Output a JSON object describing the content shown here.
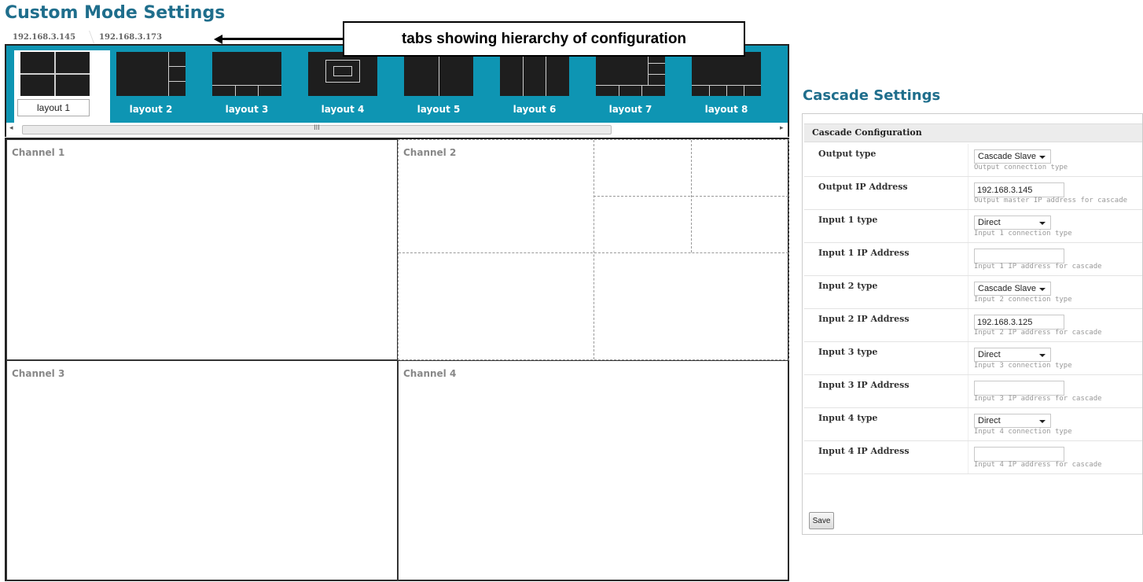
{
  "page": {
    "title": "Custom Mode Settings"
  },
  "breadcrumb": [
    "192.168.3.145",
    "192.168.3.173"
  ],
  "annotation": {
    "text": "tabs showing hierarchy of configuration"
  },
  "layouts": [
    {
      "label": "layout 1",
      "active": true
    },
    {
      "label": "layout 2",
      "active": false
    },
    {
      "label": "layout 3",
      "active": false
    },
    {
      "label": "layout 4",
      "active": false
    },
    {
      "label": "layout 5",
      "active": false
    },
    {
      "label": "layout 6",
      "active": false
    },
    {
      "label": "layout 7",
      "active": false
    },
    {
      "label": "layout 8",
      "active": false
    }
  ],
  "scrollbar": {
    "grip": "III",
    "left_arrow": "◂",
    "right_arrow": "▸"
  },
  "channels": [
    "Channel 1",
    "Channel 2",
    "Channel 3",
    "Channel 4"
  ],
  "cascade": {
    "title": "Cascade Settings",
    "header": "Cascade Configuration",
    "fields": [
      {
        "label": "Output type",
        "kind": "select",
        "value": "Cascade Slave",
        "help": "Output connection type"
      },
      {
        "label": "Output IP Address",
        "kind": "text",
        "value": "192.168.3.145",
        "help": "Output master IP address for cascade"
      },
      {
        "label": "Input 1 type",
        "kind": "select",
        "value": "Direct",
        "help": "Input 1 connection type"
      },
      {
        "label": "Input 1 IP Address",
        "kind": "text",
        "value": "",
        "help": "Input 1 IP address for cascade"
      },
      {
        "label": "Input 2 type",
        "kind": "select",
        "value": "Cascade Slave",
        "help": "Input 2 connection type"
      },
      {
        "label": "Input 2 IP Address",
        "kind": "text",
        "value": "192.168.3.125",
        "help": "Input 2 IP address for cascade"
      },
      {
        "label": "Input 3 type",
        "kind": "select",
        "value": "Direct",
        "help": "Input 3 connection type"
      },
      {
        "label": "Input 3 IP Address",
        "kind": "text",
        "value": "",
        "help": "Input 3 IP address for cascade"
      },
      {
        "label": "Input 4 type",
        "kind": "select",
        "value": "Direct",
        "help": "Input 4 connection type"
      },
      {
        "label": "Input 4 IP Address",
        "kind": "text",
        "value": "",
        "help": "Input 4 IP address for cascade"
      }
    ],
    "save_label": "Save"
  },
  "colors": {
    "accent": "#0e95b3",
    "title": "#1f6e8c",
    "thumb": "#1e1e1e"
  },
  "icons": [
    "left-arrow-icon",
    "scroll-left-icon",
    "scroll-right-icon",
    "dropdown-caret-icon"
  ]
}
